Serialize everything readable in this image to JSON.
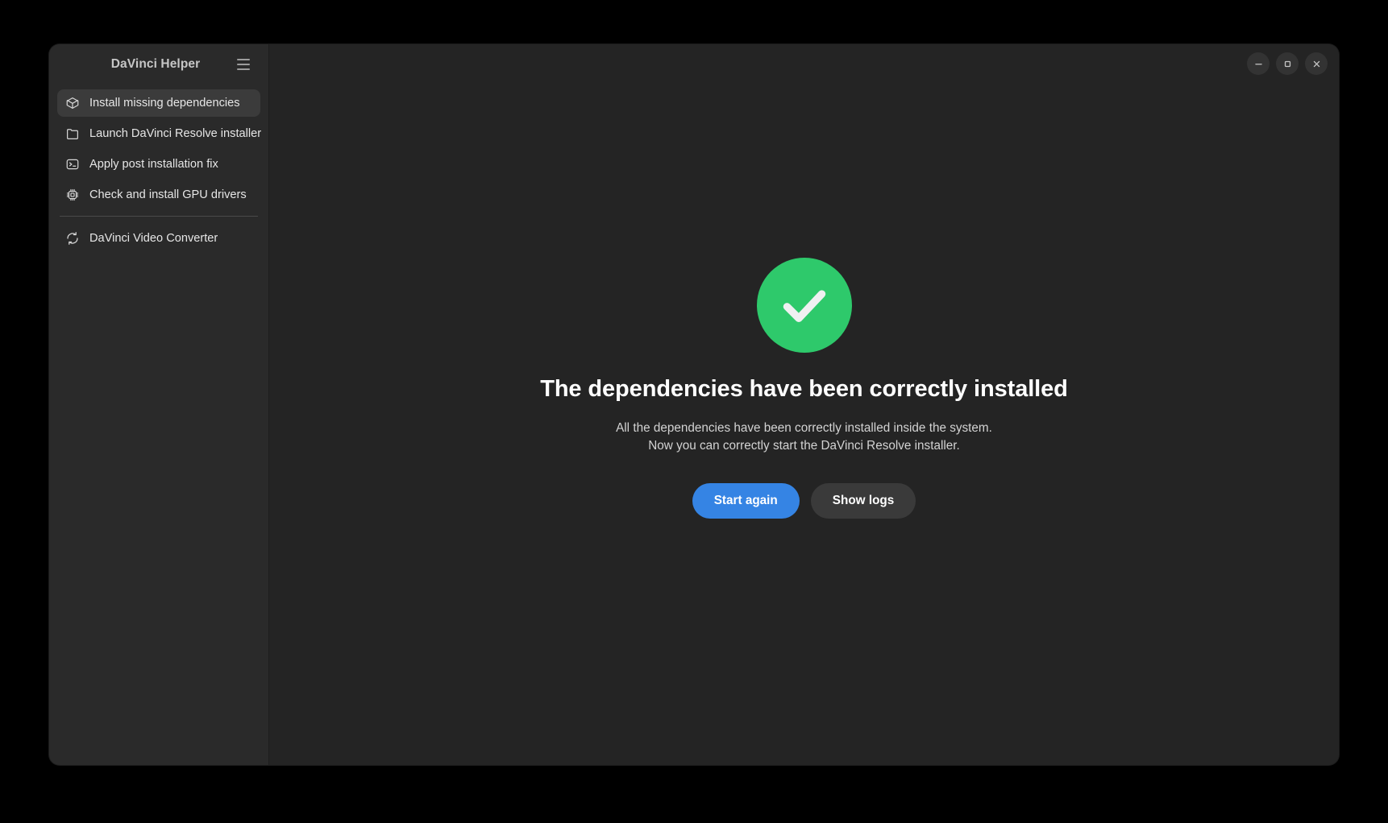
{
  "window": {
    "title": "DaVinci Helper",
    "menu_icon": "hamburger-menu-icon",
    "controls": [
      {
        "name": "minimize",
        "icon": "minimize-icon",
        "glyph": "–"
      },
      {
        "name": "maximize",
        "icon": "maximize-icon",
        "glyph": "□"
      },
      {
        "name": "close",
        "icon": "close-icon",
        "glyph": "×"
      }
    ]
  },
  "sidebar": {
    "items": [
      {
        "label": "Install missing dependencies",
        "icon": "package-icon",
        "selected": true
      },
      {
        "label": "Launch DaVinci Resolve installer",
        "icon": "folder-icon",
        "selected": false
      },
      {
        "label": "Apply post installation fix",
        "icon": "terminal-icon",
        "selected": false
      },
      {
        "label": "Check and install GPU drivers",
        "icon": "chip-icon",
        "selected": false
      }
    ],
    "footer_items": [
      {
        "label": "DaVinci Video Converter",
        "icon": "refresh-icon",
        "selected": false
      }
    ]
  },
  "main": {
    "status_icon": "success-check-icon",
    "heading": "The dependencies have been correctly installed",
    "body_line_1": "All the dependencies have been correctly installed inside the system.",
    "body_line_2": "Now you can correctly start the DaVinci Resolve installer.",
    "buttons": {
      "primary_label": "Start again",
      "secondary_label": "Show logs"
    }
  },
  "colors": {
    "desktop_background": "#000000",
    "window_background": "#242424",
    "sidebar_background": "#2a2a2a",
    "selected_item": "#3b3b3b",
    "accent_blue": "#3584e4",
    "success_green": "#2ec96b",
    "secondary_button": "#3a3a3a",
    "text_primary": "#ffffff",
    "text_secondary": "#d3d3d3"
  }
}
